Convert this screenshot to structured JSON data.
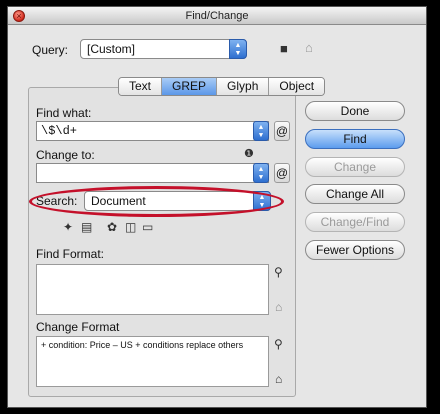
{
  "window": {
    "title": "Find/Change"
  },
  "query": {
    "label": "Query:",
    "value": "[Custom]",
    "save_icon": "floppy-save-icon",
    "delete_icon": "trash-icon"
  },
  "tabs": [
    {
      "label": "Text",
      "active": false
    },
    {
      "label": "GREP",
      "active": true
    },
    {
      "label": "Glyph",
      "active": false
    },
    {
      "label": "Object",
      "active": false
    }
  ],
  "find_what": {
    "label": "Find what:",
    "value": "\\$\\d+",
    "special_char": "@"
  },
  "change_to": {
    "label": "Change to:",
    "value": "",
    "special_char": "@",
    "info_glyph": "❶"
  },
  "search": {
    "label": "Search:",
    "value": "Document"
  },
  "find_format": {
    "label": "Find Format:",
    "value": ""
  },
  "change_format": {
    "label": "Change Format",
    "value": "+ condition: Price – US  + conditions replace others"
  },
  "buttons": {
    "done": "Done",
    "find": "Find",
    "change": "Change",
    "change_all": "Change All",
    "change_find": "Change/Find",
    "fewer_options": "Fewer Options"
  },
  "colors": {
    "accent": "#5c97e8",
    "highlight_oval": "#c4102a"
  }
}
